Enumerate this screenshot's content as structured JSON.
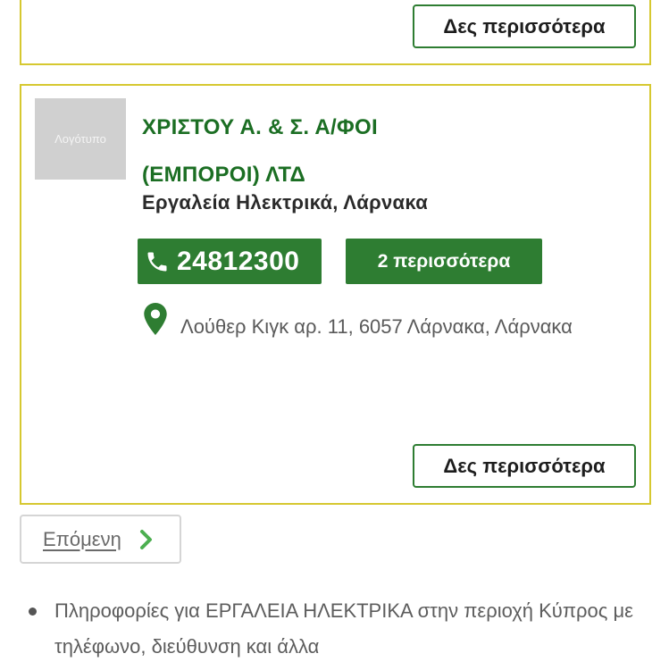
{
  "top_card": {
    "more_label": "Δες περισσότερα"
  },
  "listing": {
    "logo_placeholder": "Λογότυπο",
    "name_line1": "ΧΡΙΣΤΟΥ Α. & Σ. Α/ΦΟΙ",
    "name_line2": "(ΕΜΠΟΡΟΙ) ΛΤΔ",
    "category": "Εργαλεία Ηλεκτρικά, Λάρνακα",
    "phone": "24812300",
    "more_phones_label": "2 περισσότερα",
    "address": "Λούθερ Κιγκ αρ. 11, 6057 Λάρνακα, Λάρνακα",
    "more_label": "Δες περισσότερα"
  },
  "pagination": {
    "next_label": "Επόμενη"
  },
  "info": {
    "text": "Πληροφορίες για ΕΡΓΑΛΕΙΑ ΗΛΕΚΤΡΙΚΑ στην περιοχή Κύπρος με τηλέφωνο, διεύθυνση και άλλα"
  },
  "colors": {
    "brand_green": "#2e7d32",
    "card_border": "#d6c830"
  },
  "icons": {
    "phone": "phone-icon",
    "pin": "map-pin-icon",
    "next": "chevron-right-icon"
  }
}
